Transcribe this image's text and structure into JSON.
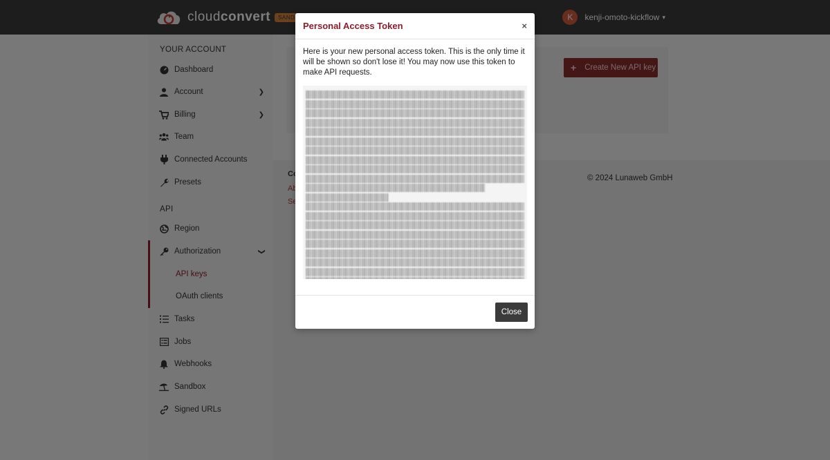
{
  "header": {
    "logo_text_light": "cloud",
    "logo_text_bold": "convert",
    "badge": "SANDBOX",
    "user_initial": "K",
    "username": "kenji-omoto-kickflow",
    "caret": "⌄"
  },
  "sidebar": {
    "section_account": "YOUR ACCOUNT",
    "section_api": "API",
    "items": [
      {
        "label": "Dashboard",
        "icon": "dashboard-icon"
      },
      {
        "label": "Account",
        "icon": "user-icon"
      },
      {
        "label": "Billing",
        "icon": "cart-icon"
      },
      {
        "label": "Team",
        "icon": "team-icon"
      },
      {
        "label": "Connected Accounts",
        "icon": "plug-icon"
      },
      {
        "label": "Presets",
        "icon": "wrench-icon"
      },
      {
        "label": "Region",
        "icon": "globe-icon"
      },
      {
        "label": "Authorization",
        "icon": "key-icon"
      },
      {
        "label": "API keys"
      },
      {
        "label": "OAuth clients"
      },
      {
        "label": "Tasks",
        "icon": "tasks-icon"
      },
      {
        "label": "Jobs",
        "icon": "jobs-icon"
      },
      {
        "label": "Webhooks",
        "icon": "bell-icon"
      },
      {
        "label": "Sandbox",
        "icon": "beach-icon"
      },
      {
        "label": "Signed URLs",
        "icon": "link-icon"
      }
    ]
  },
  "main": {
    "create_button": "Create New API key",
    "footer_col_title": "Co",
    "footer_links": [
      "Ab",
      "Se"
    ],
    "copyright": "© 2024 Lunaweb GmbH"
  },
  "modal": {
    "title": "Personal Access Token",
    "close_x": "×",
    "text": "Here is your new personal access token. This is the only time it will be shown so don't lose it! You may now use this token to make API requests.",
    "close_button": "Close"
  },
  "colors": {
    "accent": "#8b1e2b",
    "topbar": "#3a3a3a",
    "badge": "#d9823b"
  }
}
